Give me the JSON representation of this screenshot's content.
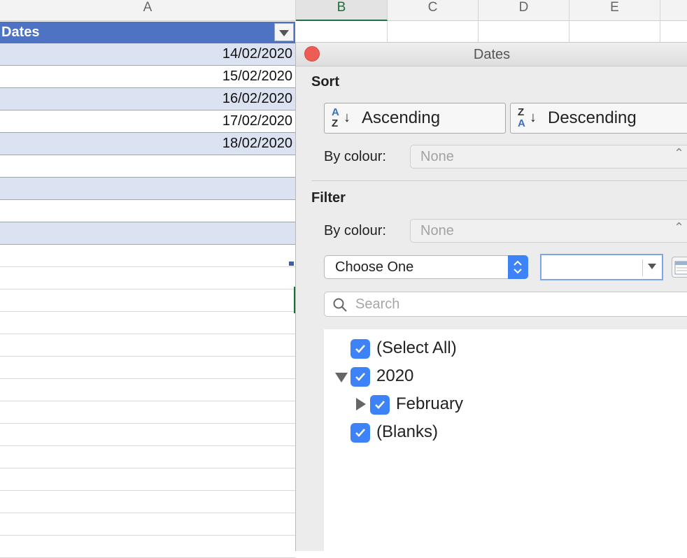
{
  "sheet": {
    "columns": [
      "A",
      "B",
      "C",
      "D",
      "E"
    ],
    "header_cell": "Dates",
    "dates": [
      "14/02/2020",
      "15/02/2020",
      "16/02/2020",
      "17/02/2020",
      "18/02/2020"
    ]
  },
  "panel": {
    "title": "Dates",
    "sort": {
      "section_label": "Sort",
      "ascending_label": "Ascending",
      "descending_label": "Descending",
      "by_colour_label": "By colour:",
      "by_colour_value": "None"
    },
    "filter": {
      "section_label": "Filter",
      "by_colour_label": "By colour:",
      "by_colour_value": "None",
      "condition_value": "Choose One",
      "value_field": "",
      "search_placeholder": "Search"
    },
    "list": [
      {
        "label": "(Select All)",
        "checked": true
      },
      {
        "label": "2020",
        "checked": true,
        "expanded": true
      },
      {
        "label": "February",
        "checked": true,
        "expanded": false
      },
      {
        "label": "(Blanks)",
        "checked": true
      }
    ]
  },
  "colors": {
    "table_header": "#4e73c3",
    "band": "#dbe2f1",
    "checkbox": "#3d82f6",
    "close_button": "#ee5d55"
  }
}
